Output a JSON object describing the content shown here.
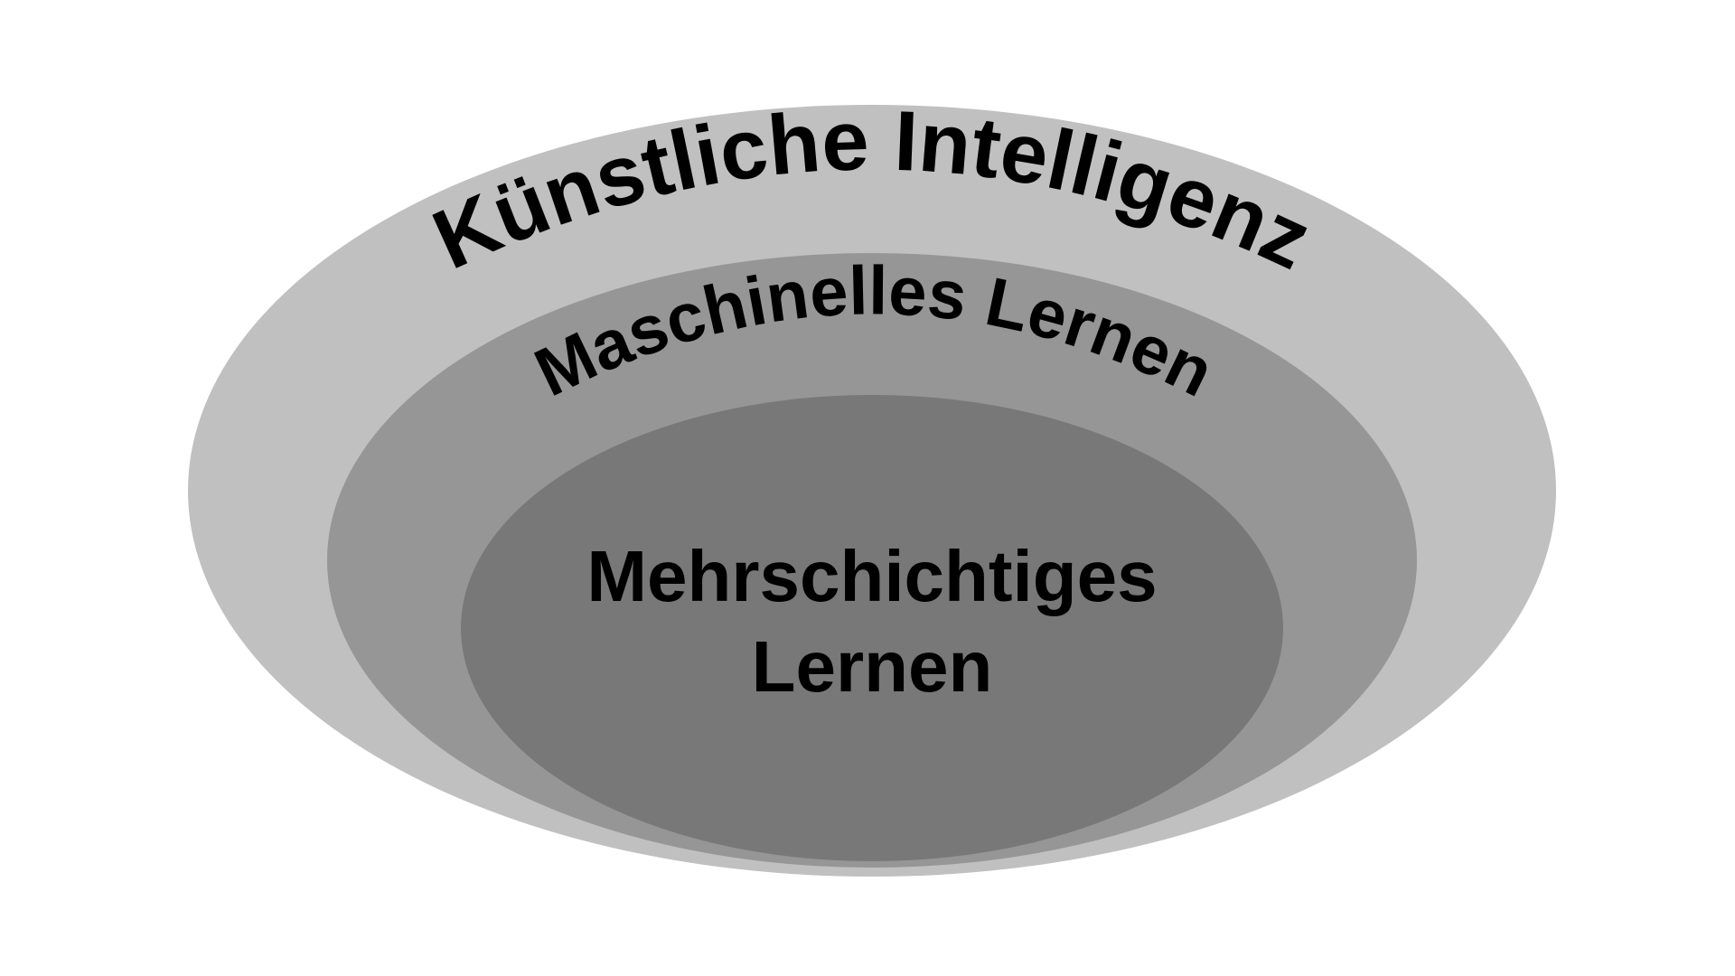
{
  "diagram": {
    "layers": [
      {
        "label": "Künstliche Intelligenz",
        "color": "#c0c0c0"
      },
      {
        "label": "Maschinelles Lernen",
        "color": "#969696"
      },
      {
        "label_lines": [
          "Mehrschichtiges",
          "Lernen"
        ],
        "color": "#787878"
      }
    ],
    "background": "#ffffff",
    "text_color": "#000000"
  }
}
